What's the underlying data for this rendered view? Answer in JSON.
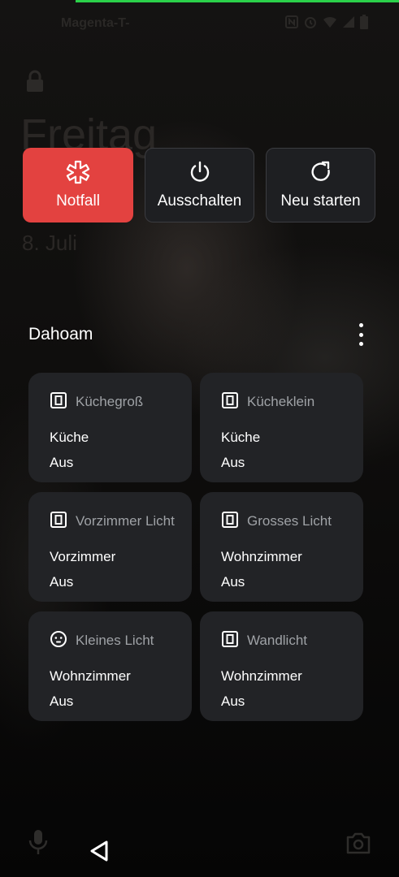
{
  "status_bar": {
    "carrier": "Magenta-T-",
    "icons": [
      "nfc-icon",
      "alarm-icon",
      "wifi-icon",
      "signal-icon",
      "battery-icon"
    ]
  },
  "lockscreen": {
    "day": "Freitag",
    "date": "8. Juli"
  },
  "power_menu": {
    "emergency_label": "Notfall",
    "power_off_label": "Ausschalten",
    "restart_label": "Neu starten",
    "emergency_color": "#e34240"
  },
  "home": {
    "title": "Dahoam",
    "devices": [
      {
        "name": "Küchegroß",
        "room": "Küche",
        "state": "Aus",
        "icon": "switch-icon"
      },
      {
        "name": "Kücheklein",
        "room": "Küche",
        "state": "Aus",
        "icon": "switch-icon"
      },
      {
        "name": "Vorzimmer Licht",
        "room": "Vorzimmer",
        "state": "Aus",
        "icon": "switch-icon"
      },
      {
        "name": "Grosses Licht",
        "room": "Wohnzimmer",
        "state": "Aus",
        "icon": "switch-icon"
      },
      {
        "name": "Kleines Licht",
        "room": "Wohnzimmer",
        "state": "Aus",
        "icon": "outlet-icon"
      },
      {
        "name": "Wandlicht",
        "room": "Wohnzimmer",
        "state": "Aus",
        "icon": "switch-icon"
      }
    ]
  }
}
